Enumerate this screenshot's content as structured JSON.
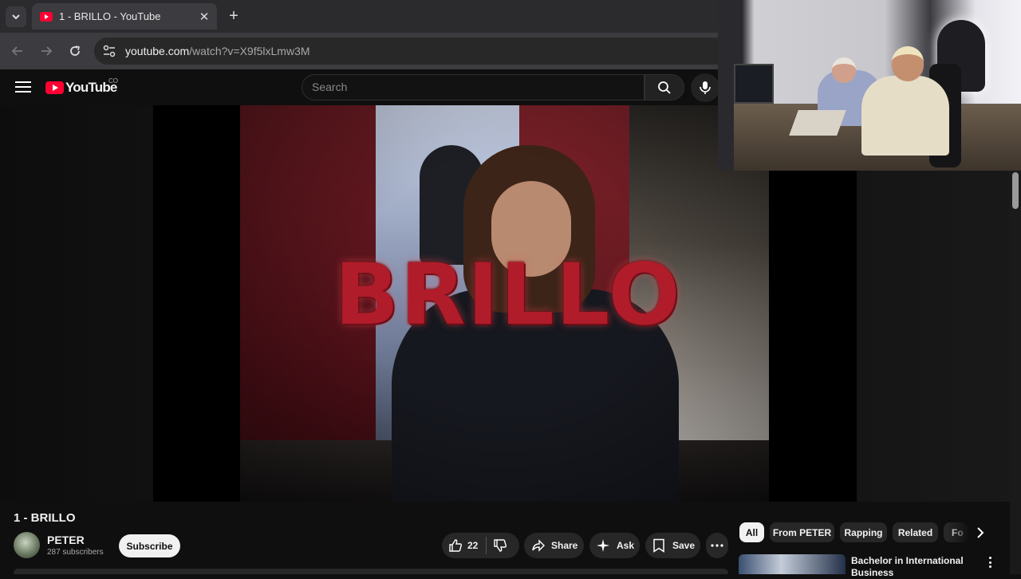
{
  "browser": {
    "tab_title": "1 - BRILLO - YouTube",
    "tab_close": "✕",
    "new_tab": "+",
    "url_host": "youtube.com",
    "url_path": "/watch?v=X9f5lxLmw3M"
  },
  "header": {
    "logo_text": "YouTube",
    "country_code": "CO",
    "search_placeholder": "Search"
  },
  "video": {
    "overlay_text": "BRILLO",
    "title": "1 - BRILLO"
  },
  "channel": {
    "name": "PETER",
    "subscribers": "287 subscribers",
    "subscribe_label": "Subscribe"
  },
  "actions": {
    "like_count": "22",
    "share_label": "Share",
    "ask_label": "Ask",
    "save_label": "Save"
  },
  "chips": [
    {
      "label": "All",
      "active": true
    },
    {
      "label": "From PETER",
      "active": false
    },
    {
      "label": "Rapping",
      "active": false
    },
    {
      "label": "Related",
      "active": false
    },
    {
      "label": "Fo",
      "active": false
    }
  ],
  "recommendation": {
    "title": "Bachelor in International Business"
  },
  "colors": {
    "youtube_red": "#ff0033",
    "brillo_red": "#b01c2a",
    "page_bg": "#0f0f0f"
  }
}
